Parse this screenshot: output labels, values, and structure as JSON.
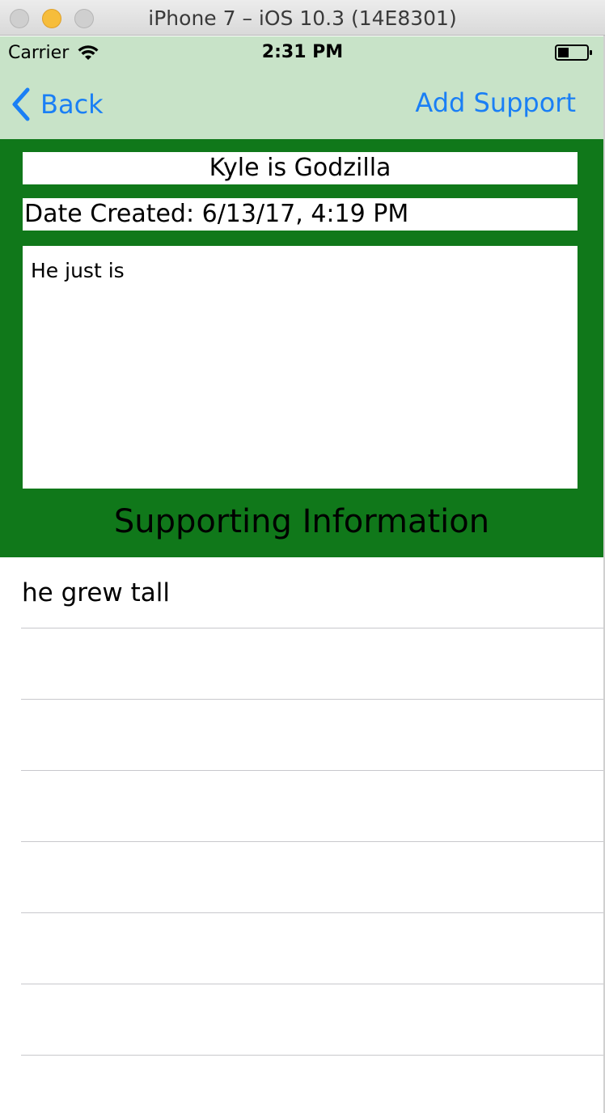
{
  "window": {
    "title": "iPhone 7 – iOS 10.3 (14E8301)"
  },
  "status_bar": {
    "carrier": "Carrier",
    "time": "2:31 PM",
    "wifi_icon": "wifi-icon",
    "battery_icon": "battery-icon"
  },
  "nav": {
    "back_label": "Back",
    "back_icon": "chevron-left-icon",
    "right_button": "Add Support",
    "tint_color": "#1a7ff5",
    "background": "#c8e3c8"
  },
  "header": {
    "title": "Kyle is Godzilla",
    "date_created": "Date Created: 6/13/17, 4:19 PM",
    "description": "He just is",
    "section_heading": "Supporting Information",
    "background": "#10781a"
  },
  "table": {
    "rows": [
      {
        "label": "he grew tall"
      },
      {
        "label": ""
      },
      {
        "label": ""
      },
      {
        "label": ""
      },
      {
        "label": ""
      },
      {
        "label": ""
      },
      {
        "label": ""
      }
    ]
  }
}
